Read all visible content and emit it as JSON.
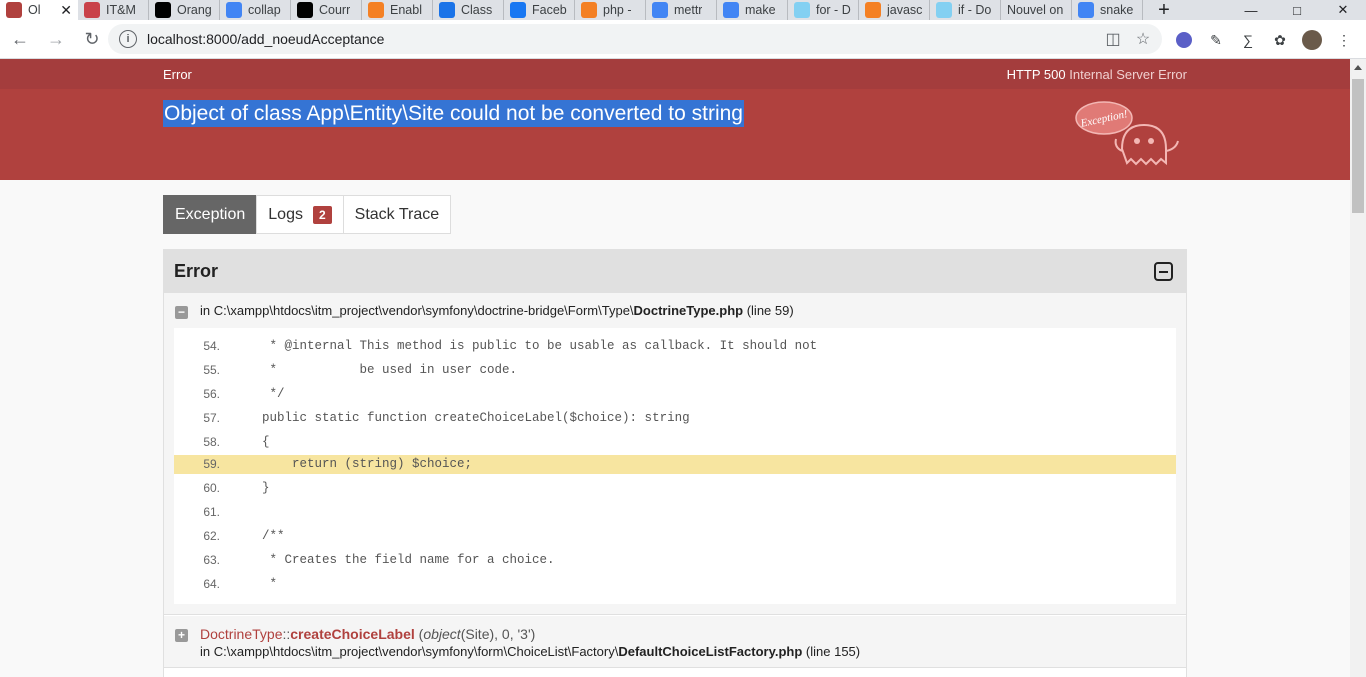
{
  "browser": {
    "tabs": [
      {
        "label": "Ol",
        "icon": "symfony-error-favicon",
        "color": "#b0413e",
        "active": true
      },
      {
        "label": "IT&M",
        "icon": "itm-favicon",
        "color": "#c9424a"
      },
      {
        "label": "Orang",
        "icon": "symfony-favicon",
        "color": "#000000"
      },
      {
        "label": "collap",
        "icon": "google-favicon",
        "color": "#4285f4"
      },
      {
        "label": "Courr",
        "icon": "mail-favicon",
        "color": "#000000"
      },
      {
        "label": "Enabl",
        "icon": "stackoverflow-favicon",
        "color": "#f48024"
      },
      {
        "label": "Class",
        "icon": "loading-favicon",
        "color": "#1a73e8"
      },
      {
        "label": "Faceb",
        "icon": "facebook-favicon",
        "color": "#1877f2"
      },
      {
        "label": "php -",
        "icon": "stackoverflow-favicon",
        "color": "#f48024"
      },
      {
        "label": "mettr",
        "icon": "google-favicon",
        "color": "#4285f4"
      },
      {
        "label": "make",
        "icon": "google-favicon",
        "color": "#4285f4"
      },
      {
        "label": "for - D",
        "icon": "mdn-favicon",
        "color": "#83d0f2"
      },
      {
        "label": "javasc",
        "icon": "stackoverflow-favicon",
        "color": "#f48024"
      },
      {
        "label": "if - Do",
        "icon": "mdn-favicon",
        "color": "#83d0f2"
      },
      {
        "label": "Nouvel on",
        "icon": "",
        "color": ""
      },
      {
        "label": "snake",
        "icon": "google-favicon",
        "color": "#4285f4"
      }
    ],
    "new_tab": "+",
    "url": "localhost:8000/add_noeudAcceptance"
  },
  "error": {
    "label": "Error",
    "status_code": "HTTP 500",
    "status_text": "Internal Server Error",
    "message": "Object of class App\\Entity\\Site could not be converted to string",
    "ghost_text": "Exception!"
  },
  "tabs": {
    "exception": "Exception",
    "logs": "Logs",
    "logs_count": "2",
    "stack_trace": "Stack Trace"
  },
  "trace": {
    "title": "Error",
    "frame1": {
      "prefix": "in",
      "path": "C:\\xampp\\htdocs\\itm_project\\vendor\\symfony\\doctrine-bridge\\Form\\Type\\",
      "file": "DoctrineType.php",
      "line": "(line 59)"
    },
    "code": [
      {
        "no": "54.",
        "text": " * @internal This method is public to be usable as callback. It should not"
      },
      {
        "no": "55.",
        "text": " *           be used in user code."
      },
      {
        "no": "56.",
        "text": " */"
      },
      {
        "no": "57.",
        "text": "public static function createChoiceLabel($choice): string"
      },
      {
        "no": "58.",
        "text": "{"
      },
      {
        "no": "59.",
        "text": "    return (string) $choice;"
      },
      {
        "no": "60.",
        "text": "}"
      },
      {
        "no": "61.",
        "text": ""
      },
      {
        "no": "62.",
        "text": "/**"
      },
      {
        "no": "63.",
        "text": " * Creates the field name for a choice."
      },
      {
        "no": "64.",
        "text": " *"
      }
    ],
    "frame2": {
      "class": "DoctrineType",
      "sep": "::",
      "function": "createChoiceLabel",
      "args_open": "(",
      "args_obj": "object",
      "args_rest": "(Site), 0, '3')",
      "prefix": "in",
      "path": "C:\\xampp\\htdocs\\itm_project\\vendor\\symfony\\form\\ChoiceList\\Factory\\",
      "file": "DefaultChoiceListFactory.php",
      "line": "(line 155)"
    }
  }
}
